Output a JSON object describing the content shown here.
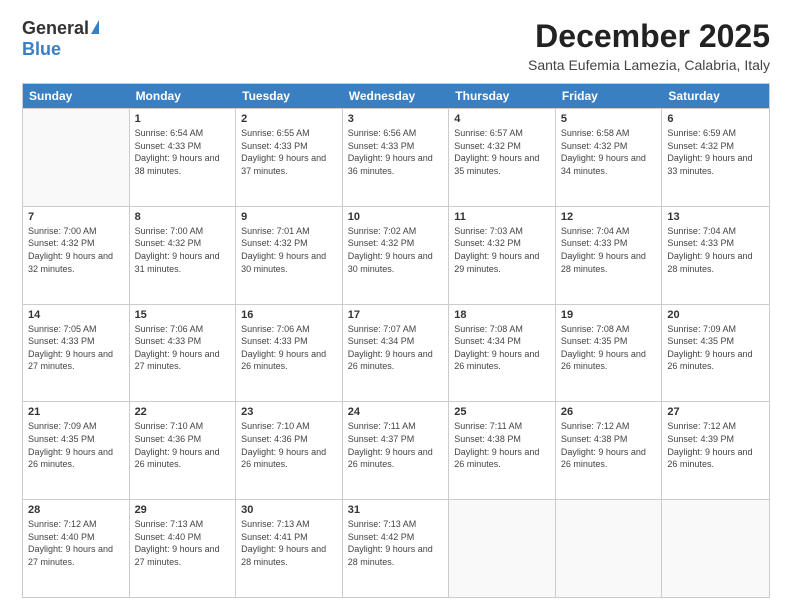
{
  "logo": {
    "general": "General",
    "blue": "Blue"
  },
  "title": "December 2025",
  "location": "Santa Eufemia Lamezia, Calabria, Italy",
  "header_days": [
    "Sunday",
    "Monday",
    "Tuesday",
    "Wednesday",
    "Thursday",
    "Friday",
    "Saturday"
  ],
  "weeks": [
    [
      {
        "day": "",
        "sunrise": "",
        "sunset": "",
        "daylight": ""
      },
      {
        "day": "1",
        "sunrise": "Sunrise: 6:54 AM",
        "sunset": "Sunset: 4:33 PM",
        "daylight": "Daylight: 9 hours and 38 minutes."
      },
      {
        "day": "2",
        "sunrise": "Sunrise: 6:55 AM",
        "sunset": "Sunset: 4:33 PM",
        "daylight": "Daylight: 9 hours and 37 minutes."
      },
      {
        "day": "3",
        "sunrise": "Sunrise: 6:56 AM",
        "sunset": "Sunset: 4:33 PM",
        "daylight": "Daylight: 9 hours and 36 minutes."
      },
      {
        "day": "4",
        "sunrise": "Sunrise: 6:57 AM",
        "sunset": "Sunset: 4:32 PM",
        "daylight": "Daylight: 9 hours and 35 minutes."
      },
      {
        "day": "5",
        "sunrise": "Sunrise: 6:58 AM",
        "sunset": "Sunset: 4:32 PM",
        "daylight": "Daylight: 9 hours and 34 minutes."
      },
      {
        "day": "6",
        "sunrise": "Sunrise: 6:59 AM",
        "sunset": "Sunset: 4:32 PM",
        "daylight": "Daylight: 9 hours and 33 minutes."
      }
    ],
    [
      {
        "day": "7",
        "sunrise": "Sunrise: 7:00 AM",
        "sunset": "Sunset: 4:32 PM",
        "daylight": "Daylight: 9 hours and 32 minutes."
      },
      {
        "day": "8",
        "sunrise": "Sunrise: 7:00 AM",
        "sunset": "Sunset: 4:32 PM",
        "daylight": "Daylight: 9 hours and 31 minutes."
      },
      {
        "day": "9",
        "sunrise": "Sunrise: 7:01 AM",
        "sunset": "Sunset: 4:32 PM",
        "daylight": "Daylight: 9 hours and 30 minutes."
      },
      {
        "day": "10",
        "sunrise": "Sunrise: 7:02 AM",
        "sunset": "Sunset: 4:32 PM",
        "daylight": "Daylight: 9 hours and 30 minutes."
      },
      {
        "day": "11",
        "sunrise": "Sunrise: 7:03 AM",
        "sunset": "Sunset: 4:32 PM",
        "daylight": "Daylight: 9 hours and 29 minutes."
      },
      {
        "day": "12",
        "sunrise": "Sunrise: 7:04 AM",
        "sunset": "Sunset: 4:33 PM",
        "daylight": "Daylight: 9 hours and 28 minutes."
      },
      {
        "day": "13",
        "sunrise": "Sunrise: 7:04 AM",
        "sunset": "Sunset: 4:33 PM",
        "daylight": "Daylight: 9 hours and 28 minutes."
      }
    ],
    [
      {
        "day": "14",
        "sunrise": "Sunrise: 7:05 AM",
        "sunset": "Sunset: 4:33 PM",
        "daylight": "Daylight: 9 hours and 27 minutes."
      },
      {
        "day": "15",
        "sunrise": "Sunrise: 7:06 AM",
        "sunset": "Sunset: 4:33 PM",
        "daylight": "Daylight: 9 hours and 27 minutes."
      },
      {
        "day": "16",
        "sunrise": "Sunrise: 7:06 AM",
        "sunset": "Sunset: 4:33 PM",
        "daylight": "Daylight: 9 hours and 26 minutes."
      },
      {
        "day": "17",
        "sunrise": "Sunrise: 7:07 AM",
        "sunset": "Sunset: 4:34 PM",
        "daylight": "Daylight: 9 hours and 26 minutes."
      },
      {
        "day": "18",
        "sunrise": "Sunrise: 7:08 AM",
        "sunset": "Sunset: 4:34 PM",
        "daylight": "Daylight: 9 hours and 26 minutes."
      },
      {
        "day": "19",
        "sunrise": "Sunrise: 7:08 AM",
        "sunset": "Sunset: 4:35 PM",
        "daylight": "Daylight: 9 hours and 26 minutes."
      },
      {
        "day": "20",
        "sunrise": "Sunrise: 7:09 AM",
        "sunset": "Sunset: 4:35 PM",
        "daylight": "Daylight: 9 hours and 26 minutes."
      }
    ],
    [
      {
        "day": "21",
        "sunrise": "Sunrise: 7:09 AM",
        "sunset": "Sunset: 4:35 PM",
        "daylight": "Daylight: 9 hours and 26 minutes."
      },
      {
        "day": "22",
        "sunrise": "Sunrise: 7:10 AM",
        "sunset": "Sunset: 4:36 PM",
        "daylight": "Daylight: 9 hours and 26 minutes."
      },
      {
        "day": "23",
        "sunrise": "Sunrise: 7:10 AM",
        "sunset": "Sunset: 4:36 PM",
        "daylight": "Daylight: 9 hours and 26 minutes."
      },
      {
        "day": "24",
        "sunrise": "Sunrise: 7:11 AM",
        "sunset": "Sunset: 4:37 PM",
        "daylight": "Daylight: 9 hours and 26 minutes."
      },
      {
        "day": "25",
        "sunrise": "Sunrise: 7:11 AM",
        "sunset": "Sunset: 4:38 PM",
        "daylight": "Daylight: 9 hours and 26 minutes."
      },
      {
        "day": "26",
        "sunrise": "Sunrise: 7:12 AM",
        "sunset": "Sunset: 4:38 PM",
        "daylight": "Daylight: 9 hours and 26 minutes."
      },
      {
        "day": "27",
        "sunrise": "Sunrise: 7:12 AM",
        "sunset": "Sunset: 4:39 PM",
        "daylight": "Daylight: 9 hours and 26 minutes."
      }
    ],
    [
      {
        "day": "28",
        "sunrise": "Sunrise: 7:12 AM",
        "sunset": "Sunset: 4:40 PM",
        "daylight": "Daylight: 9 hours and 27 minutes."
      },
      {
        "day": "29",
        "sunrise": "Sunrise: 7:13 AM",
        "sunset": "Sunset: 4:40 PM",
        "daylight": "Daylight: 9 hours and 27 minutes."
      },
      {
        "day": "30",
        "sunrise": "Sunrise: 7:13 AM",
        "sunset": "Sunset: 4:41 PM",
        "daylight": "Daylight: 9 hours and 28 minutes."
      },
      {
        "day": "31",
        "sunrise": "Sunrise: 7:13 AM",
        "sunset": "Sunset: 4:42 PM",
        "daylight": "Daylight: 9 hours and 28 minutes."
      },
      {
        "day": "",
        "sunrise": "",
        "sunset": "",
        "daylight": ""
      },
      {
        "day": "",
        "sunrise": "",
        "sunset": "",
        "daylight": ""
      },
      {
        "day": "",
        "sunrise": "",
        "sunset": "",
        "daylight": ""
      }
    ]
  ]
}
